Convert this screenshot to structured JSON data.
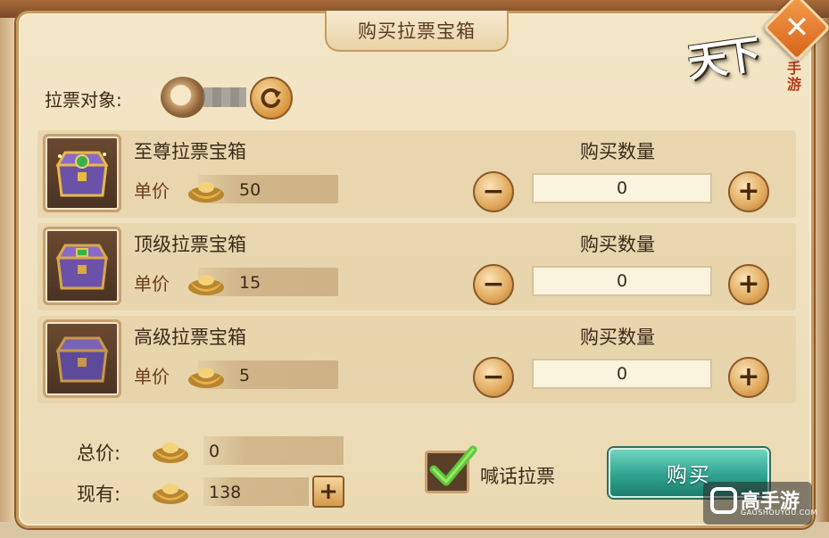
{
  "dialog": {
    "title": "购买拉票宝箱",
    "close_symbol": "✕",
    "logo_main": "天下",
    "logo_sub": "手游"
  },
  "target": {
    "label": "拉票对象:",
    "refresh_icon": "refresh-icon"
  },
  "items": [
    {
      "name": "至尊拉票宝箱",
      "unit_label": "单价",
      "price": "50",
      "qty_title": "购买数量",
      "qty": "0",
      "minus": "−",
      "plus": "+"
    },
    {
      "name": "顶级拉票宝箱",
      "unit_label": "单价",
      "price": "15",
      "qty_title": "购买数量",
      "qty": "0",
      "minus": "−",
      "plus": "+"
    },
    {
      "name": "高级拉票宝箱",
      "unit_label": "单价",
      "price": "5",
      "qty_title": "购买数量",
      "qty": "0",
      "minus": "−",
      "plus": "+"
    }
  ],
  "summary": {
    "total_label": "总价:",
    "total_value": "0",
    "owned_label": "现有:",
    "owned_value": "138",
    "add_symbol": "+"
  },
  "shout": {
    "label": "喊话拉票",
    "checked": true
  },
  "buy_button": "购买",
  "watermark": {
    "text": "高手游",
    "sub": "GAOSHOUYOU.COM"
  },
  "colors": {
    "panel": "#efe0bd",
    "border": "#c99a5c",
    "buy_button": "#2fa38f",
    "close_button": "#e07a2e"
  }
}
